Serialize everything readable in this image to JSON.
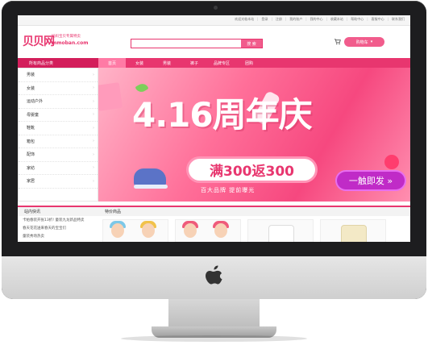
{
  "site": {
    "logo": "贝贝网",
    "tagline": "妈妈宝贝专属特卖",
    "domain": "mmoban.com"
  },
  "top_links": [
    "欢迎光临本站",
    "登录",
    "注册",
    "我的账户",
    "我的中心",
    "收藏本站",
    "帮助中心",
    "客服中心",
    "联系我们"
  ],
  "search": {
    "placeholder": "",
    "button_label": "搜 索"
  },
  "cart": {
    "label": "购物车"
  },
  "nav": {
    "all_categories": "所有商品分类",
    "items": [
      "首页",
      "女装",
      "男装",
      "裤子",
      "品牌专区",
      "团购"
    ]
  },
  "categories": [
    "男装",
    "女装",
    "运动户外",
    "母婴童",
    "鞋靴",
    "箱包",
    "配饰",
    "家纺",
    "家居"
  ],
  "banner": {
    "headline": "4.16周年庆",
    "promo": "满300返300",
    "subtitle": "百大品牌   提前曝光",
    "cta": "一触即发 »",
    "colors": {
      "accent": "#e8366f",
      "cta": "#c02bc7"
    }
  },
  "news": {
    "title": "站内快讯",
    "items": [
      "卡帕春装开张13折! 童装九龙新品特卖",
      "春天花花送来春天的宝宝们",
      "童装秀场热卖"
    ]
  },
  "products": {
    "title": "特价商品"
  }
}
